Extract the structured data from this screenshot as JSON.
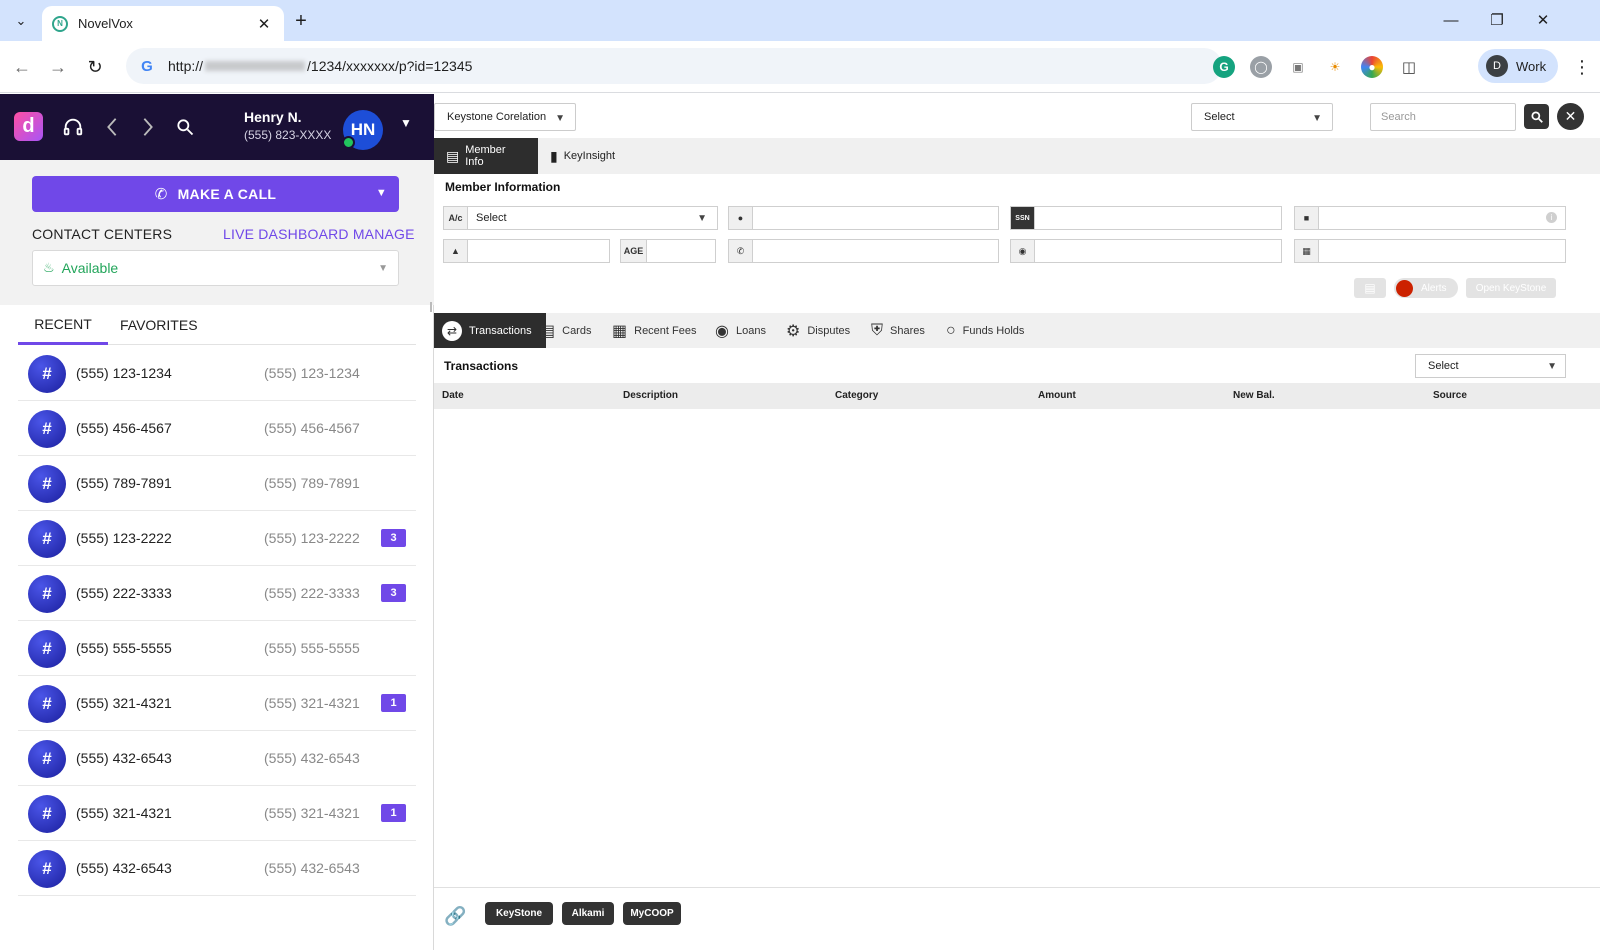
{
  "browser": {
    "tab_title": "NovelVox",
    "url_prefix": "http://",
    "url_suffix": "/1234/xxxxxxx/p?id=12345",
    "profile_label": "Work",
    "profile_initial": "D"
  },
  "header": {
    "user_name": "Henry N.",
    "user_phone": "(555) 823-XXXX",
    "user_initials": "HN"
  },
  "dialer": {
    "make_call_label": "MAKE A CALL",
    "contact_centers_label": "CONTACT CENTERS",
    "live_dashboard_label": "LIVE DASHBOARD MANAGE",
    "status": "Available"
  },
  "list_tabs": {
    "recent": "RECENT",
    "favorites": "FAVORITES"
  },
  "recent": [
    {
      "primary": "(555) 123-1234",
      "secondary": "(555) 123-1234",
      "badge": ""
    },
    {
      "primary": "(555) 456-4567",
      "secondary": "(555) 456-4567",
      "badge": ""
    },
    {
      "primary": "(555) 789-7891",
      "secondary": "(555) 789-7891",
      "badge": ""
    },
    {
      "primary": "(555) 123-2222",
      "secondary": "(555) 123-2222",
      "badge": "3"
    },
    {
      "primary": "(555) 222-3333",
      "secondary": "(555) 222-3333",
      "badge": "3"
    },
    {
      "primary": "(555) 555-5555",
      "secondary": "(555) 555-5555",
      "badge": ""
    },
    {
      "primary": "(555) 321-4321",
      "secondary": "(555) 321-4321",
      "badge": "1"
    },
    {
      "primary": "(555) 432-6543",
      "secondary": "(555) 432-6543",
      "badge": ""
    },
    {
      "primary": "(555) 321-4321",
      "secondary": "(555) 321-4321",
      "badge": "1"
    },
    {
      "primary": "(555) 432-6543",
      "secondary": "(555) 432-6543",
      "badge": ""
    }
  ],
  "crm": {
    "integration_select": "Keystone Corelation",
    "search_type_select": "Select",
    "search_placeholder": "Search",
    "tabs": {
      "member_info": "Member Info",
      "key_insight": "KeyInsight"
    },
    "member_section_title": "Member Information",
    "account_label": "A/c",
    "account_select": "Select",
    "ssn_label": "SSN",
    "age_label": "AGE",
    "alerts_label": "Alerts",
    "open_keystone_label": "Open KeyStone",
    "tx_tabs": {
      "transactions": "Transactions",
      "cards": "Cards",
      "recent_fees": "Recent Fees",
      "loans": "Loans",
      "disputes": "Disputes",
      "shares": "Shares",
      "funds_holds": "Funds Holds"
    },
    "transactions_title": "Transactions",
    "transactions_filter": "Select",
    "columns": {
      "date": "Date",
      "description": "Description",
      "category": "Category",
      "amount": "Amount",
      "new_bal": "New Bal.",
      "source": "Source"
    },
    "footer_links": {
      "keystone": "KeyStone",
      "alkami": "Alkami",
      "mycoop": "MyCOOP"
    }
  },
  "colors": {
    "accent": "#7048e8",
    "header_bg": "#1a1035",
    "available": "#22a55a",
    "dark_tab": "#2d2d2d"
  }
}
